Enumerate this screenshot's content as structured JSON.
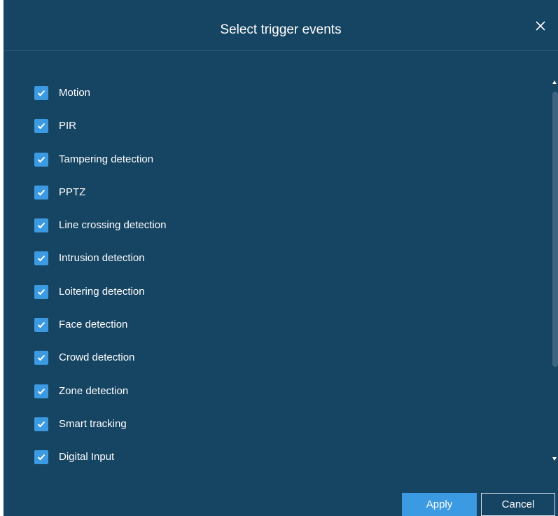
{
  "dialog": {
    "title": "Select trigger events",
    "close_icon": "close-icon",
    "items": [
      {
        "label": "Motion",
        "checked": true
      },
      {
        "label": "PIR",
        "checked": true
      },
      {
        "label": "Tampering detection",
        "checked": true
      },
      {
        "label": "PPTZ",
        "checked": true
      },
      {
        "label": "Line crossing detection",
        "checked": true
      },
      {
        "label": "Intrusion detection",
        "checked": true
      },
      {
        "label": "Loitering detection",
        "checked": true
      },
      {
        "label": "Face detection",
        "checked": true
      },
      {
        "label": "Crowd detection",
        "checked": true
      },
      {
        "label": "Zone detection",
        "checked": true
      },
      {
        "label": "Smart tracking",
        "checked": true
      },
      {
        "label": "Digital Input",
        "checked": true
      }
    ],
    "apply_label": "Apply",
    "cancel_label": "Cancel"
  },
  "colors": {
    "background": "#164463",
    "checkbox": "#3b9ae1",
    "apply_button": "#3b9ae1",
    "text": "#ffffff"
  }
}
